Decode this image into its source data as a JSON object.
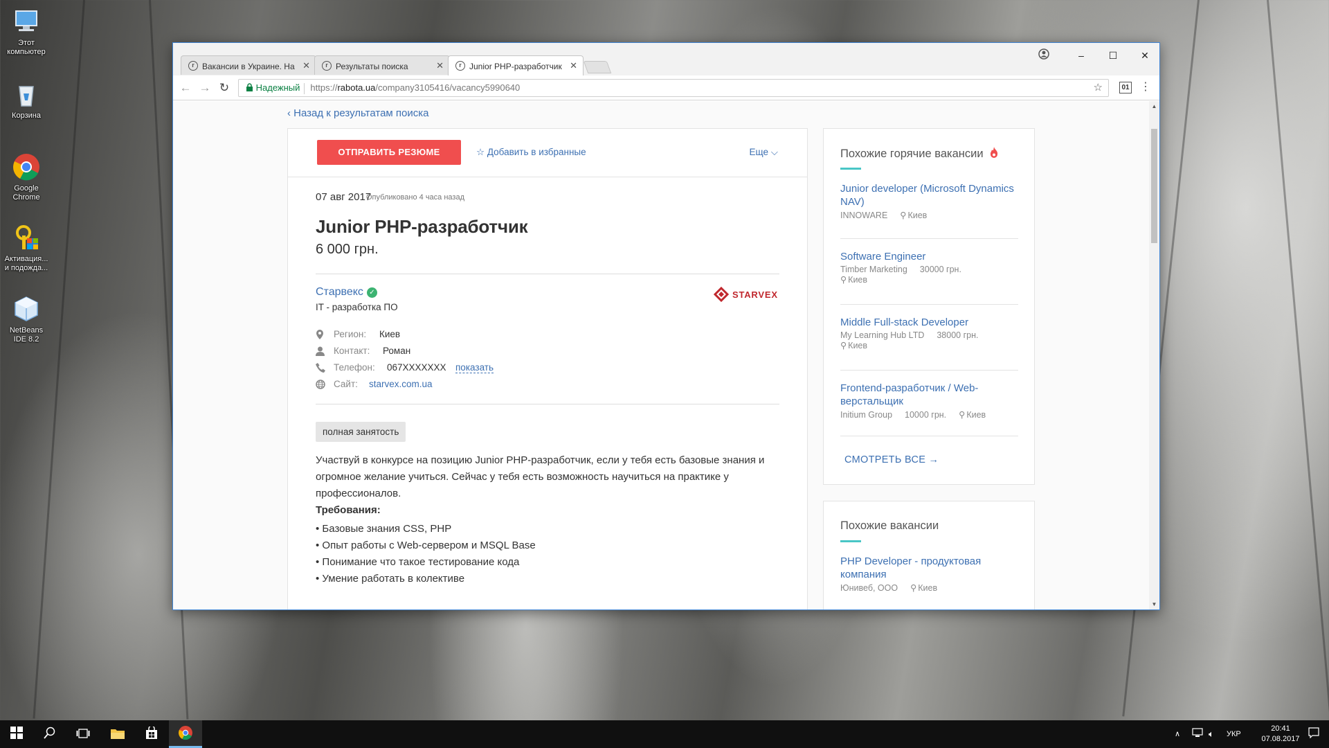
{
  "desktop": {
    "icons": [
      {
        "label": "Этот компьютер",
        "icon": "computer-icon"
      },
      {
        "label": "Корзина",
        "icon": "recycle-bin-icon"
      },
      {
        "label": "Google Chrome",
        "icon": "chrome-icon"
      },
      {
        "label": "Активация... и подожда...",
        "icon": "activation-icon"
      },
      {
        "label": "NetBeans IDE 8.2",
        "icon": "netbeans-icon"
      }
    ]
  },
  "browser": {
    "tabs": [
      {
        "label": "Вакансии в Украине. На",
        "active": false
      },
      {
        "label": "Результаты поиска",
        "active": false
      },
      {
        "label": "Junior PHP-разработчик",
        "active": true
      }
    ],
    "favicon_glyph": "r",
    "close_glyph": "✕",
    "window_controls": {
      "minimize": "–",
      "maximize": "☐",
      "close": "✕"
    },
    "address": {
      "secure_label": "Надежный",
      "protocol": "https://",
      "host": "rabota.ua",
      "path": "/company3105416/vacancy5990640"
    },
    "extension_label": "01"
  },
  "page": {
    "back_link": "‹ Назад к результатам поиска",
    "actions": {
      "send_resume": "ОТПРАВИТЬ РЕЗЮМЕ",
      "add_favorite": "☆ Добавить в избранные",
      "more": "Еще ⌵"
    },
    "vacancy": {
      "date": "07 авг 2017",
      "published": "Опубликовано 4 часа назад",
      "title": "Junior PHP-разработчик",
      "salary": "6 000 грн.",
      "company": "Старвекс",
      "industry": "IT - разработка ПО",
      "logo_text": "STARVEX",
      "region_label": "Регион:",
      "region": "Киев",
      "contact_label": "Контакт:",
      "contact": "Роман",
      "phone_label": "Телефон:",
      "phone": "067XXXXXXX",
      "phone_show": "показать",
      "site_label": "Сайт:",
      "site": "starvex.com.ua",
      "employment_tag": "полная занятость",
      "description": "Участвуй в конкурсе на позицию Junior PHP-разработчик, если у тебя есть базовые знания и огромное желание учиться. Сейчас у тебя есть возможность научиться на практике у профессионалов.",
      "requirements_title": "Требования:",
      "requirements": [
        "Базовые знания CSS, PHP",
        "Опыт работы с Web-сервером и MSQL Base",
        "Понимание что такое тестирование кода",
        "Умение работать в колективе"
      ]
    },
    "hot_vacancies": {
      "title": "Похожие горячие вакансии",
      "items": [
        {
          "title": "Junior developer (Microsoft Dynamics NAV)",
          "company": "INNOWARE",
          "salary": "",
          "city": "Киев"
        },
        {
          "title": "Software Engineer",
          "company": "Timber Marketing",
          "salary": "30000 грн.",
          "city": "Киев"
        },
        {
          "title": "Middle Full-stack Developer",
          "company": "My Learning Hub LTD",
          "salary": "38000 грн.",
          "city": "Киев"
        },
        {
          "title": "Frontend-разработчик / Web-верстальщик",
          "company": "Initium Group",
          "salary": "10000 грн.",
          "city": "Киев"
        }
      ],
      "see_all": "СМОТРЕТЬ ВСЕ →"
    },
    "similar_vacancies": {
      "title": "Похожие вакансии",
      "items": [
        {
          "title": "PHP Developer - продуктовая компания",
          "company": "Юнивеб, ООО",
          "city": "Киев"
        }
      ]
    }
  },
  "taskbar": {
    "language": "УКР",
    "time": "20:41",
    "date": "07.08.2017"
  },
  "colors": {
    "accent_red": "#f04e4e",
    "link_blue": "#3d70b2",
    "accent_teal": "#49c6c6",
    "verified_green": "#3cb371"
  }
}
